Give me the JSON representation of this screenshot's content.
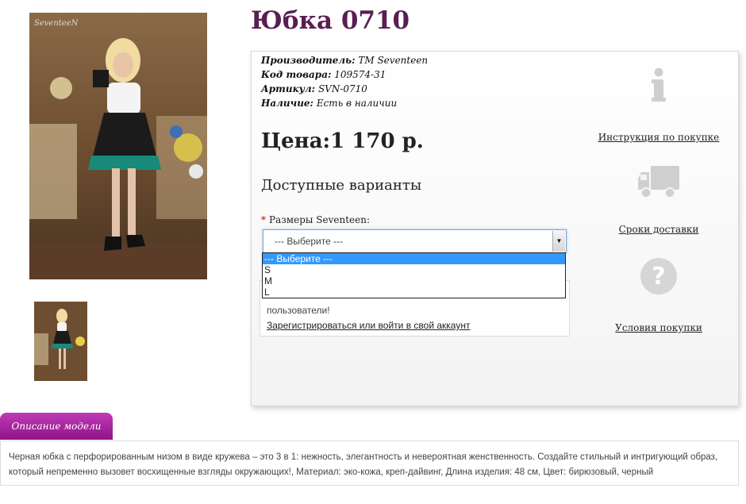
{
  "product": {
    "title": "Юбка 0710",
    "specs": [
      {
        "label": "Производитель:",
        "value": "ТМ Seventeen"
      },
      {
        "label": "Код товара:",
        "value": "109574-31"
      },
      {
        "label": "Артикул:",
        "value": "SVN-0710"
      },
      {
        "label": "Наличие:",
        "value": "Есть в наличии"
      }
    ],
    "price": "Цена:1 170 р."
  },
  "images": {
    "watermark": "SeventeeN"
  },
  "variants": {
    "heading": "Доступные варианты",
    "size_label": "Размеры Seventeen:",
    "required_mark": "*",
    "select_value": "--- Выберите ---",
    "options": [
      "--- Выберите ---",
      "S",
      "M",
      "L"
    ]
  },
  "login_notice": {
    "text": "пользователи!",
    "link": "Зарегистрироваться или войти в свой аккаунт"
  },
  "side": {
    "instruction_link": "Инструкция по покупке",
    "delivery_link": "Сроки доставки",
    "terms_link": "Условия покупки",
    "info_icon": "info-icon",
    "truck_icon": "truck-icon",
    "question_icon": "question-icon"
  },
  "description": {
    "tab_label": "Описание модели",
    "text": "Черная юбка с перфорированным низом в виде кружева – это 3 в 1: нежность, элегантность и невероятная женственность. Создайте стильный и интригующий образ, который непременно вызовет восхищенные взгляды окружающих!, Материал: эко-кожа, креп-дайвинг, Длина изделия: 48 см, Цвет: бирюзовый, черный"
  },
  "colors": {
    "title": "#5a1e52",
    "tab": "#a3229b",
    "select_highlight": "#3399ff"
  }
}
